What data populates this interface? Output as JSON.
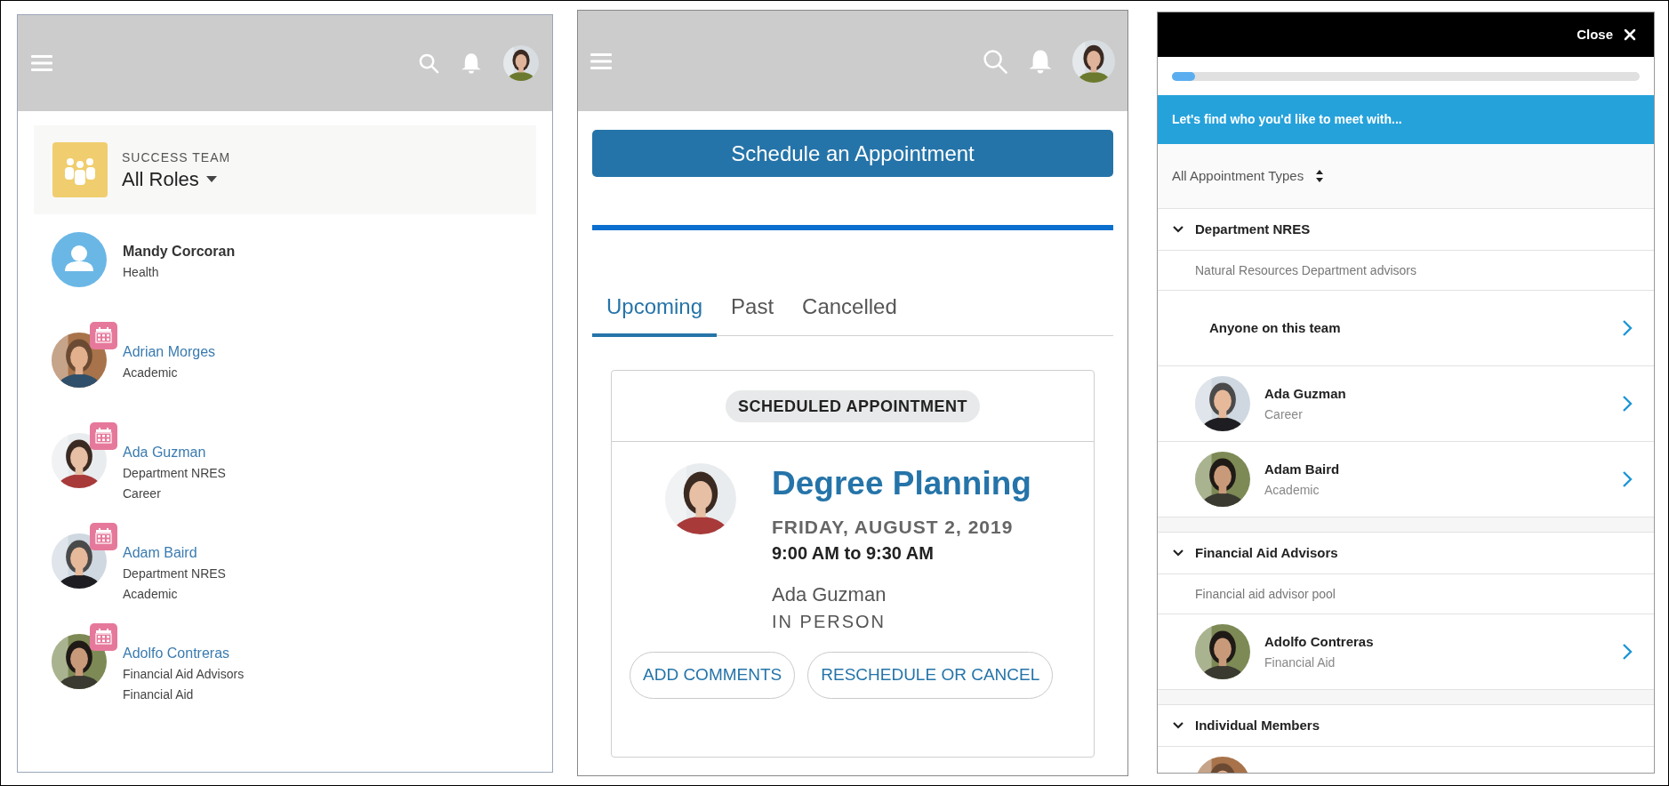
{
  "team_panel": {
    "success_team": {
      "label": "SUCCESS TEAM",
      "value": "All Roles"
    },
    "members": [
      {
        "name": "Mandy Corcoran",
        "details": [
          "Health"
        ],
        "kind": "placeholder",
        "bookable": false
      },
      {
        "name": "Adrian Morges",
        "details": [
          "Academic"
        ],
        "bookable": true
      },
      {
        "name": "Ada Guzman",
        "details": [
          "Department NRES",
          "Career"
        ],
        "bookable": true
      },
      {
        "name": "Adam Baird",
        "details": [
          "Department NRES",
          "Academic"
        ],
        "bookable": true
      },
      {
        "name": "Adolfo Contreras",
        "details": [
          "Financial Aid Advisors",
          "Financial Aid"
        ],
        "bookable": true
      }
    ]
  },
  "appointments_panel": {
    "schedule_button": "Schedule an Appointment",
    "tabs": [
      {
        "label": "Upcoming",
        "selected": true
      },
      {
        "label": "Past",
        "selected": false
      },
      {
        "label": "Cancelled",
        "selected": false
      }
    ],
    "card": {
      "badge": "SCHEDULED APPOINTMENT",
      "title": "Degree Planning",
      "date": "FRIDAY, AUGUST 2, 2019",
      "time": "9:00 AM to 9:30 AM",
      "advisor": "Ada Guzman",
      "mode": "IN PERSON",
      "buttons": [
        "ADD COMMENTS",
        "RESCHEDULE OR CANCEL"
      ]
    }
  },
  "scheduler_panel": {
    "close": "Close",
    "progress": {
      "level": 0.05
    },
    "banner": "Let's find who you'd like to meet with...",
    "filter": "All Appointment Types",
    "groups": [
      {
        "title": "Department NRES",
        "expanded": true,
        "description": "Natural Resources Department advisors",
        "options": [
          {
            "kind": "team",
            "name": "Anyone on this team"
          },
          {
            "kind": "person",
            "name": "Ada Guzman",
            "role": "Career"
          },
          {
            "kind": "person",
            "name": "Adam Baird",
            "role": "Academic"
          }
        ]
      },
      {
        "title": "Financial Aid Advisors",
        "expanded": true,
        "description": "Financial aid advisor pool",
        "options": [
          {
            "kind": "person",
            "name": "Adolfo Contreras",
            "role": "Financial Aid"
          }
        ]
      },
      {
        "title": "Individual Members",
        "expanded": true,
        "options": [
          {
            "kind": "cut"
          }
        ]
      }
    ]
  }
}
